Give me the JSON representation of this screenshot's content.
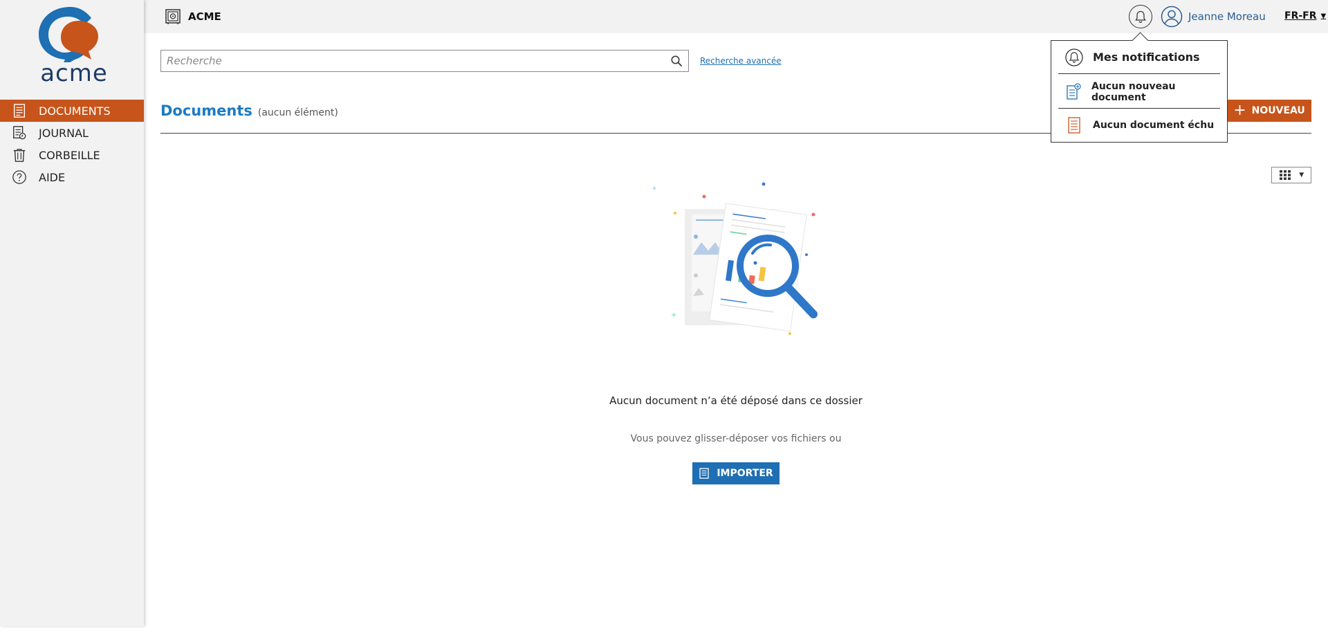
{
  "app": {
    "brand_name": "acme",
    "brand_colors": {
      "primary": "#c7541a",
      "secondary": "#1d3c66",
      "accent_blue": "#1e6fb3"
    }
  },
  "sidebar": {
    "items": [
      {
        "label": "DOCUMENTS",
        "icon": "document-icon",
        "active": true
      },
      {
        "label": "JOURNAL",
        "icon": "journal-icon",
        "active": false
      },
      {
        "label": "CORBEILLE",
        "icon": "trash-icon",
        "active": false
      },
      {
        "label": "AIDE",
        "icon": "help-icon",
        "active": false
      }
    ]
  },
  "topbar": {
    "workspace": "ACME",
    "user_name": "Jeanne Moreau",
    "language": "FR-FR"
  },
  "search": {
    "placeholder": "Recherche",
    "advanced_link": "Recherche avancée"
  },
  "main": {
    "title": "Documents",
    "count_label": "(aucun élément)",
    "new_button": "NOUVEAU",
    "empty_message": "Aucun document n’a été déposé dans ce dossier",
    "drag_message": "Vous pouvez glisser-déposer vos fichiers ou",
    "import_button": "IMPORTER"
  },
  "notifications": {
    "title": "Mes notifications",
    "items": [
      {
        "label": "Aucun nouveau document",
        "icon": "new-document-icon"
      },
      {
        "label": "Aucun document échu",
        "icon": "expired-document-icon"
      }
    ]
  }
}
